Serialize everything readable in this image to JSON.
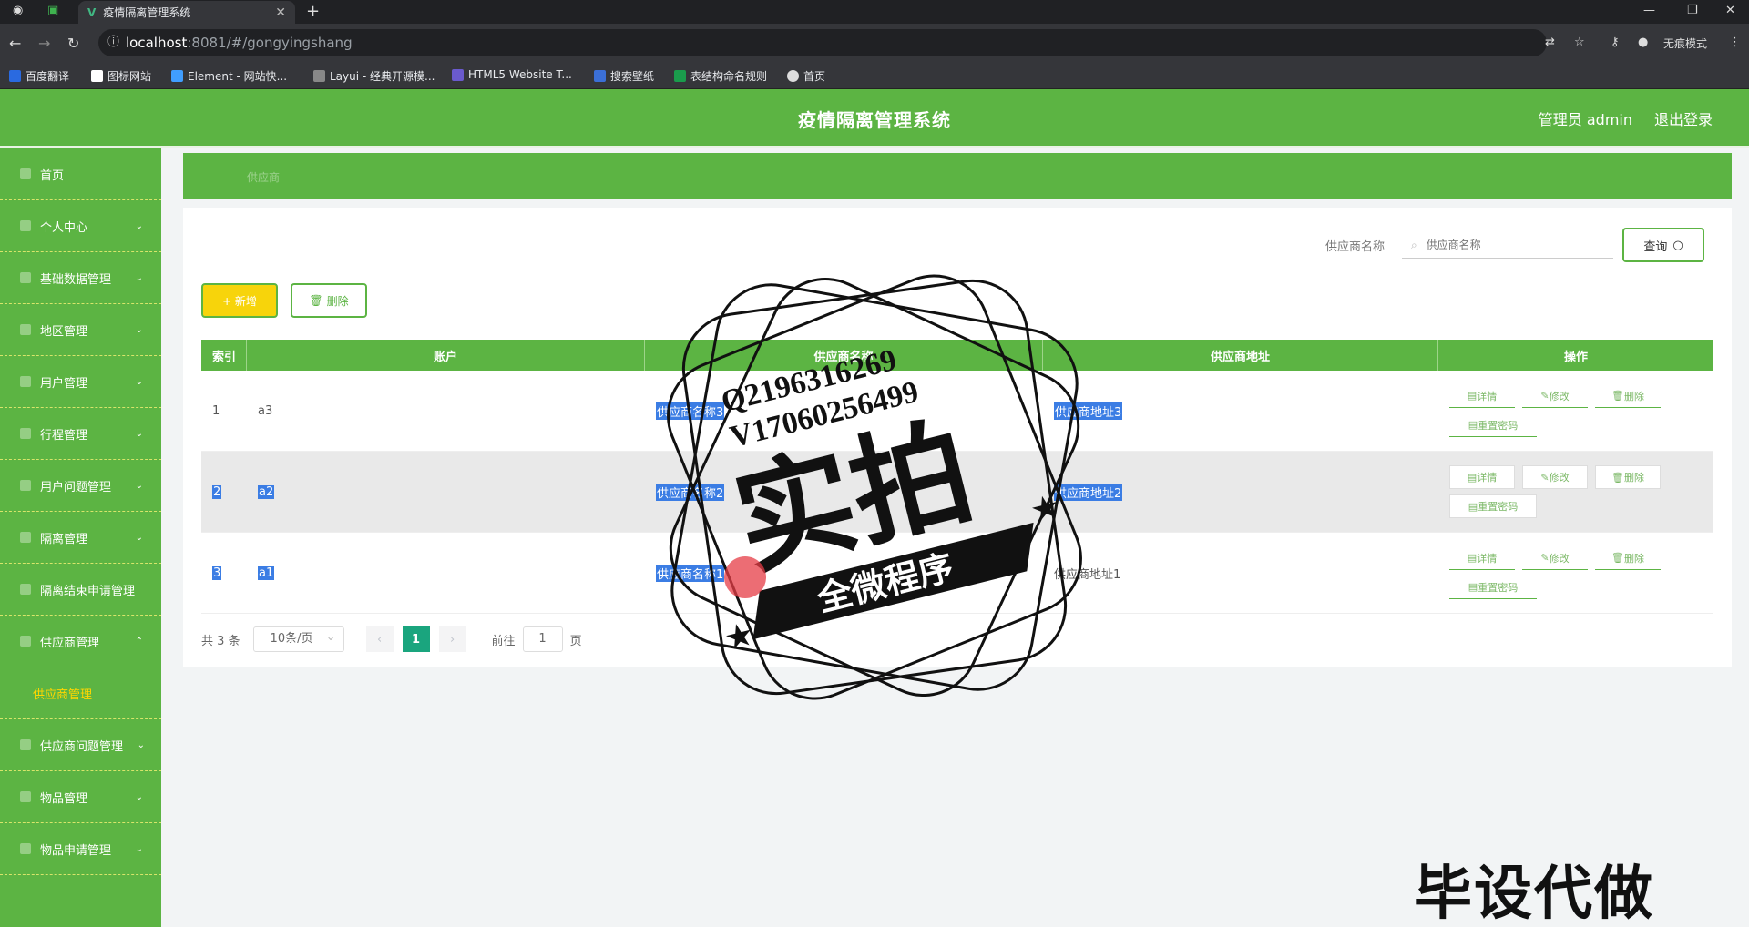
{
  "browser": {
    "active_tab_title": "疫情隔离管理系统",
    "url_host": "localhost",
    "url_path": ":8081/#/gongyingshang",
    "incognito_label": "无痕模式",
    "bookmarks": [
      "百度翻译",
      "图标网站",
      "Element - 网站快...",
      "Layui - 经典开源模...",
      "HTML5 Website T...",
      "搜索壁纸",
      "表结构命名规则",
      "首页"
    ]
  },
  "header": {
    "title": "疫情隔离管理系统",
    "user": "管理员 admin",
    "logout": "退出登录"
  },
  "sidebar": {
    "items": [
      {
        "label": "首页",
        "arrow": ""
      },
      {
        "label": "个人中心",
        "arrow": "⌄"
      },
      {
        "label": "基础数据管理",
        "arrow": "⌄"
      },
      {
        "label": "地区管理",
        "arrow": "⌄"
      },
      {
        "label": "用户管理",
        "arrow": "⌄"
      },
      {
        "label": "行程管理",
        "arrow": "⌄"
      },
      {
        "label": "用户问题管理",
        "arrow": "⌄"
      },
      {
        "label": "隔离管理",
        "arrow": "⌄"
      },
      {
        "label": "隔离结束申请管理",
        "arrow": ""
      },
      {
        "label": "供应商管理",
        "arrow": "⌃"
      },
      {
        "label": "供应商管理",
        "arrow": ""
      },
      {
        "label": "供应商问题管理",
        "arrow": "⌄"
      },
      {
        "label": "物品管理",
        "arrow": "⌄"
      },
      {
        "label": "物品申请管理",
        "arrow": "⌄"
      }
    ]
  },
  "breadcrumb": "供应商",
  "search": {
    "label": "供应商名称",
    "placeholder": "供应商名称",
    "button": "查询"
  },
  "actions": {
    "add": "+ 新增",
    "delete": "删除"
  },
  "table": {
    "headers": {
      "index": "索引",
      "account": "账户",
      "name": "供应商名称",
      "address": "供应商地址",
      "ops": "操作"
    },
    "rows": [
      {
        "index": "1",
        "account": "a3",
        "name": "供应商名称3",
        "address": "供应商地址3"
      },
      {
        "index": "2",
        "account": "a2",
        "name": "供应商名称2",
        "address": "供应商地址2"
      },
      {
        "index": "3",
        "account": "a1",
        "name": "供应商名称1",
        "address": "供应商地址1"
      }
    ],
    "op_labels": {
      "detail": "详情",
      "edit": "修改",
      "remove": "删除",
      "reset": "重置密码"
    }
  },
  "pager": {
    "total": "共 3 条",
    "size": "10条/页",
    "current": "1",
    "goto": "前往",
    "goto_value": "1",
    "page_unit": "页"
  },
  "watermark": {
    "line1": "Q2196316269",
    "line2": "V17060256499",
    "big": "实拍",
    "ribbon": "全微程序",
    "bottom": "毕设代做"
  },
  "colors": {
    "primary": "#5cb443",
    "accent": "#f7d40b",
    "page_active": "#1aa57e"
  }
}
